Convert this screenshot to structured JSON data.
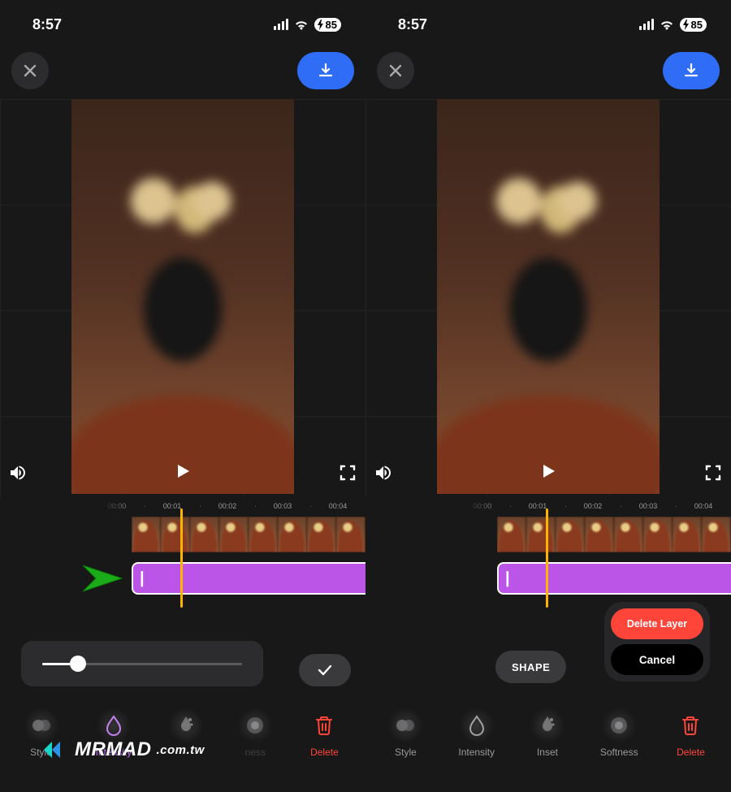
{
  "status": {
    "time": "8:57",
    "battery": "85"
  },
  "timeline": {
    "ticks": [
      "00:00",
      "00:01",
      "00:02",
      "00:03",
      "00:04"
    ]
  },
  "popup": {
    "delete": "Delete Layer",
    "cancel": "Cancel"
  },
  "shape_button": "SHAPE",
  "tools": {
    "style": "Style",
    "intensity": "Intensity",
    "inset": "Inset",
    "softness": "Softness",
    "delete": "Delete"
  },
  "watermark": {
    "brand": "MRMAD",
    "suffix": ".com.tw"
  }
}
